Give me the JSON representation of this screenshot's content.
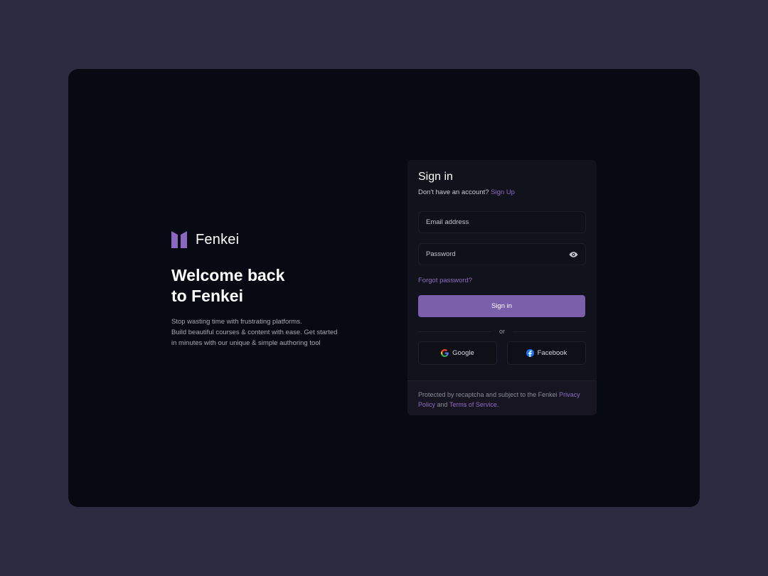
{
  "brand": {
    "name": "Fenkei",
    "logo_icon": "fenkei-logo-icon",
    "accent": "#8a68c2"
  },
  "hero": {
    "title_line1": "Welcome back",
    "title_line2": "to Fenkei",
    "subtitle_line1": "Stop wasting time with frustrating platforms.",
    "subtitle_line2": "Build beautiful courses & content with ease. Get started",
    "subtitle_line3": "in minutes with our unique & simple authoring tool"
  },
  "signin": {
    "title": "Sign in",
    "no_account": "Don't have an account?",
    "signup_link": "Sign Up",
    "email": {
      "placeholder": "Email address",
      "value": ""
    },
    "password": {
      "placeholder": "Password",
      "value": "",
      "toggle_icon": "eye-icon"
    },
    "forgot_link": "Forgot password?",
    "submit_label": "Sign in",
    "divider_text": "or",
    "google": {
      "label": "Google",
      "icon": "google-icon"
    },
    "facebook": {
      "label": "Facebook",
      "icon": "facebook-icon"
    }
  },
  "footer": {
    "prefix": "Protected by recaptcha and subject to the Fenkei",
    "privacy_link": "Privacy Policy",
    "and_text": "and",
    "terms_link": "Terms of Service",
    "suffix": "."
  },
  "colors": {
    "page_bg": "#2d2b3f",
    "window_bg": "#070a12",
    "card_bg": "#12121c",
    "primary_button": "#7a5faa",
    "link": "#8e6ec0"
  }
}
